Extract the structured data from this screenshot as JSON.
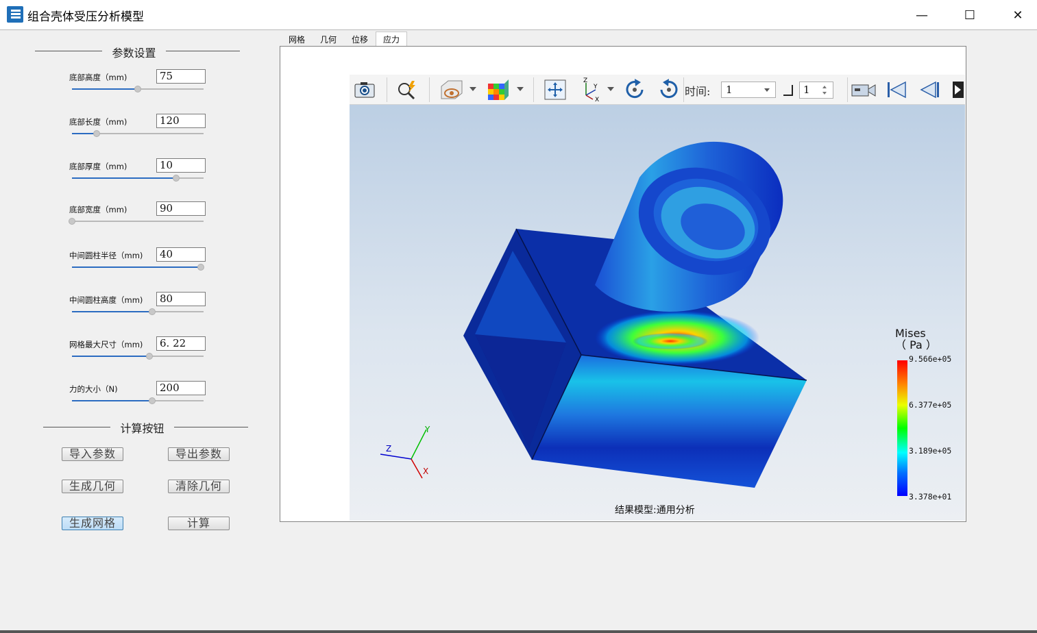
{
  "window": {
    "title": "组合壳体受压分析模型",
    "minimize": "—",
    "maximize": "☐",
    "close": "✕"
  },
  "params": {
    "group_title": "参数设置",
    "items": [
      {
        "label": "底部高度（mm)",
        "value": "75",
        "level": 0.5
      },
      {
        "label": "底部长度（mm)",
        "value": "120",
        "level": 0.19
      },
      {
        "label": "底部厚度（mm)",
        "value": "10",
        "level": 0.79
      },
      {
        "label": "底部宽度（mm)",
        "value": "90",
        "level": 0.0
      },
      {
        "label": "中间圆柱半径（mm)",
        "value": "40",
        "level": 0.98
      },
      {
        "label": "中间圆柱高度（mm)",
        "value": "80",
        "level": 0.61
      },
      {
        "label": "网格最大尺寸（mm)",
        "value": "6. 22",
        "level": 0.59
      },
      {
        "label": "力的大小（N)",
        "value": "200",
        "level": 0.61
      }
    ]
  },
  "actions": {
    "group_title": "计算按钮",
    "import": "导入参数",
    "export": "导出参数",
    "gen_geom": "生成几何",
    "clear_geom": "清除几何",
    "gen_mesh": "生成网格",
    "compute": "计算"
  },
  "tabs": [
    "网格",
    "几何",
    "位移",
    "应力"
  ],
  "viewer": {
    "time_label": "时间:",
    "time_value": "1",
    "step_value": "1",
    "model_label": "结果模型:通用分析"
  },
  "legend": {
    "title_line1": "Mises",
    "title_line2": "（ Pa ）",
    "max": "9.566e+05",
    "v2": "6.377e+05",
    "v3": "3.189e+05",
    "min": "3.378e+01"
  },
  "axes": {
    "y": "Y",
    "z": "Z",
    "x": "X"
  },
  "colors": {
    "accent": "#2a6bc1",
    "active_button": "#bcdcf6"
  }
}
